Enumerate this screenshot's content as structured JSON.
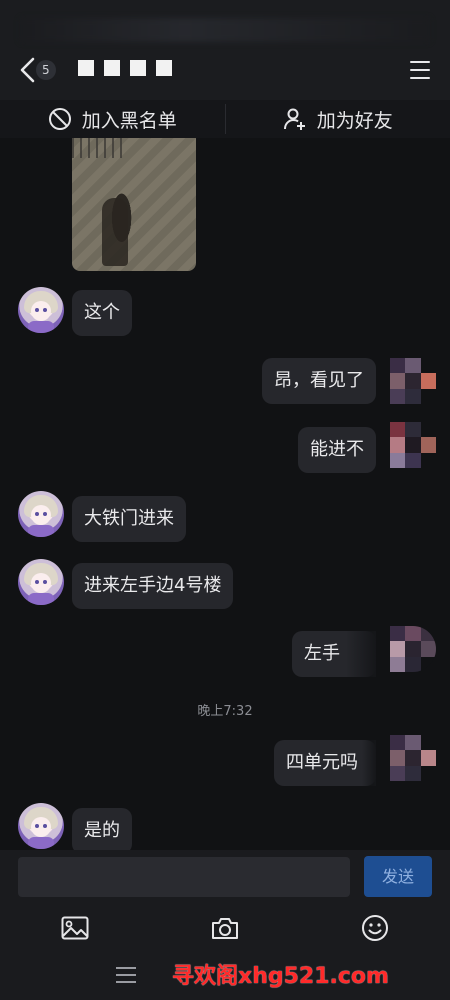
{
  "header": {
    "unread_count": "5",
    "title_masked": true
  },
  "actions": {
    "blacklist_label": "加入黑名单",
    "add_friend_label": "加为好友"
  },
  "messages": [
    {
      "side": "in",
      "text": "这个"
    },
    {
      "side": "out",
      "text": "昂，看见了"
    },
    {
      "side": "out",
      "text": "能进不"
    },
    {
      "side": "in",
      "text": "大铁门进来"
    },
    {
      "side": "in",
      "text": "进来左手边4号楼"
    },
    {
      "side": "out",
      "text": "左手"
    },
    {
      "side": "out",
      "text": "四单元吗"
    },
    {
      "side": "in",
      "text": "是的"
    }
  ],
  "timestamp": "晚上7:32",
  "input": {
    "value": "",
    "send_label": "发送"
  },
  "toolbar": {
    "icons": [
      "image-icon",
      "camera-icon",
      "emoji-icon"
    ]
  },
  "watermark": "寻欢阁xhg521.com",
  "colors": {
    "background": "#111214",
    "bubble": "#26272c",
    "send_button": "#1e4e92",
    "watermark": "#ff2a2a"
  }
}
